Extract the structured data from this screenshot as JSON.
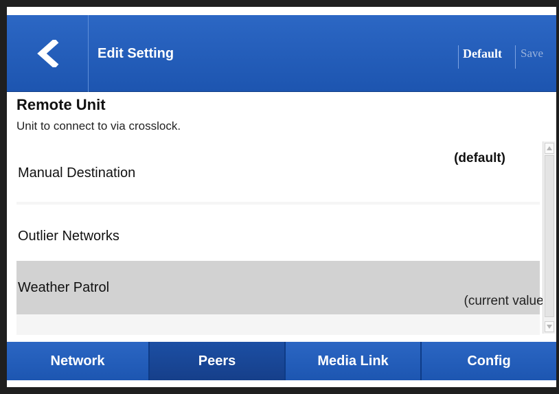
{
  "header": {
    "back_icon": "chevron-left-icon",
    "title": "Edit Setting",
    "default_label": "Default",
    "save_label": "Save",
    "color": "#2260ba"
  },
  "setting": {
    "title": "Remote Unit",
    "description": "Unit to connect to via crosslock."
  },
  "options": [
    {
      "label": "Manual Destination",
      "tag": "(default)"
    },
    {
      "label": "Outlier Networks",
      "tag": ""
    },
    {
      "label": "Weather Patrol",
      "tag": "(current value)",
      "selected": true
    }
  ],
  "scrollbar": {
    "up_icon": "arrow-up-icon",
    "down_icon": "arrow-down-icon"
  },
  "tabs": [
    {
      "label": "Network"
    },
    {
      "label": "Peers",
      "active": true
    },
    {
      "label": "Media Link"
    },
    {
      "label": "Config"
    }
  ]
}
